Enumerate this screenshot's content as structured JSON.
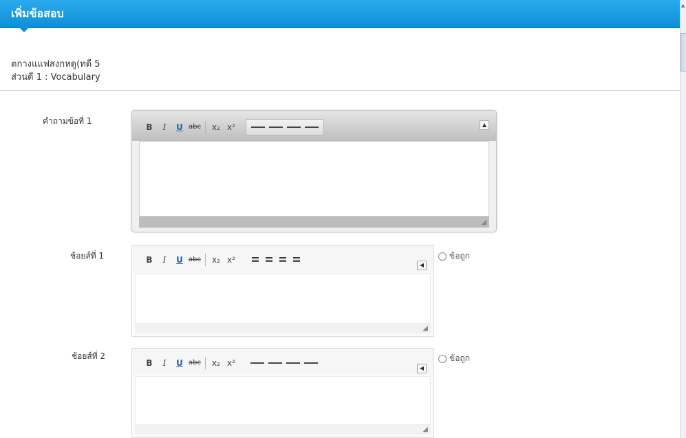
{
  "header": {
    "title": "เพิ่มข้อสอบ"
  },
  "info": {
    "line1": "ตกางแแฟสงกหดู(ทดี 5",
    "line2": "ส่วนดี 1 : Vocabulary"
  },
  "question": {
    "label": "คำถามข้อที่ 1"
  },
  "choices": [
    {
      "label": "ช้อยส์ที่ 1",
      "radio_label": "ข้อถูก"
    },
    {
      "label": "ช้อยส์ที่ 2",
      "radio_label": "ข้อถูก"
    }
  ],
  "toolbar": {
    "bold": "B",
    "italic": "I",
    "underline": "U",
    "strike": "abc",
    "subscript": "x₂",
    "superscript": "x²",
    "collapse": "▲",
    "collapse_small": "◀",
    "grip": "◢"
  }
}
